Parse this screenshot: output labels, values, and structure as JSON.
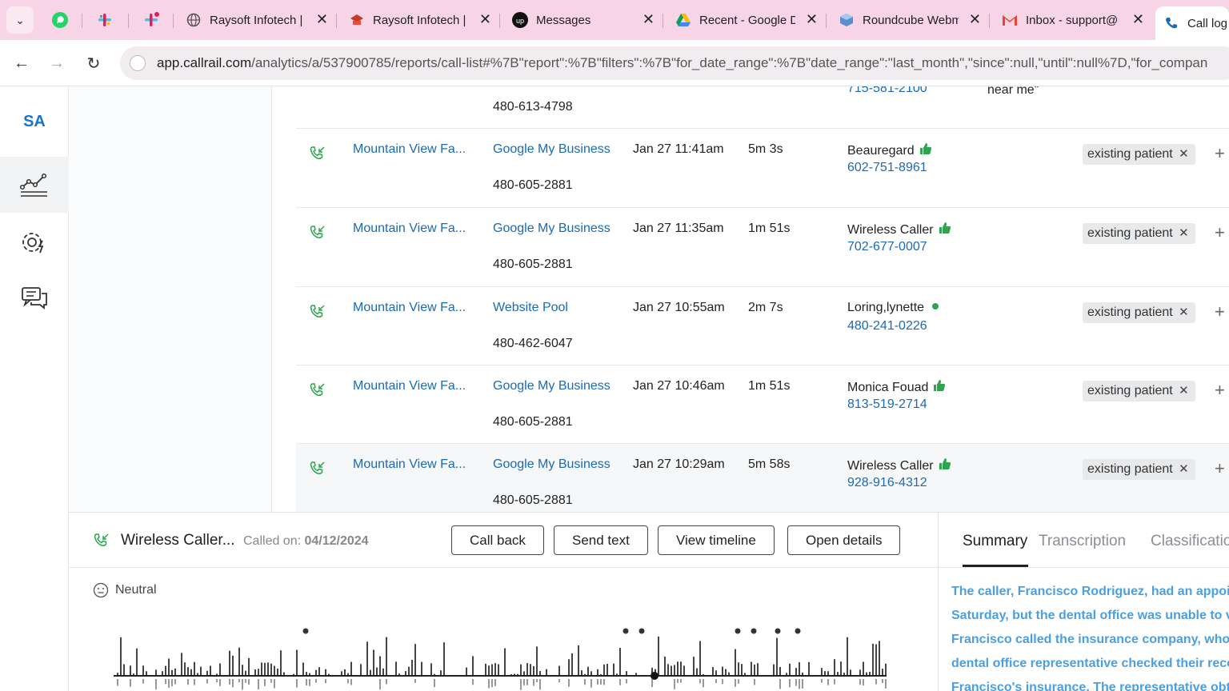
{
  "browser": {
    "tabs": [
      {
        "label": "Raysoft Infotech |",
        "icon": "globe-icon"
      },
      {
        "label": "Raysoft Infotech |",
        "icon": "hat-logo-icon"
      },
      {
        "label": "Messages",
        "icon": "upwork-icon"
      },
      {
        "label": "Recent - Google D",
        "icon": "google-drive-icon"
      },
      {
        "label": "Roundcube Webm",
        "icon": "roundcube-icon"
      },
      {
        "label": "Inbox - support@",
        "icon": "gmail-icon"
      },
      {
        "label": "Call log",
        "icon": "phone-icon"
      }
    ],
    "url_host": "app.callrail.com",
    "url_rest": "/analytics/a/537900785/reports/call-list#%7B\"report\":%7B\"filters\":%7B\"for_date_range\":%7B\"date_range\":\"last_month\",\"since\":null,\"until\":null%7D,\"for_compan"
  },
  "sidebar": {
    "logo": "SA",
    "items": [
      {
        "icon": "analytics-chart-icon",
        "active": true
      },
      {
        "icon": "settings-gear-icon",
        "active": false
      },
      {
        "icon": "chat-bubbles-icon",
        "active": false
      }
    ]
  },
  "top_partial": {
    "tracking": "480-613-4798",
    "caller_phone": "715-581-2100",
    "keyword": "near me\""
  },
  "rows": [
    {
      "company": "Mountain View Fa...",
      "source": "Google My Business",
      "tracking": "480-605-2881",
      "datetime": "Jan 27 11:41am",
      "duration": "5m 3s",
      "caller": "Beauregard",
      "phone": "602-751-8961",
      "indicator": "thumb",
      "tag": "existing patient"
    },
    {
      "company": "Mountain View Fa...",
      "source": "Google My Business",
      "tracking": "480-605-2881",
      "datetime": "Jan 27 11:35am",
      "duration": "1m 51s",
      "caller": "Wireless Caller",
      "phone": "702-677-0007",
      "indicator": "thumb",
      "tag": "existing patient"
    },
    {
      "company": "Mountain View Fa...",
      "source": "Website Pool",
      "tracking": "480-462-6047",
      "datetime": "Jan 27 10:55am",
      "duration": "2m 7s",
      "caller": "Loring,lynette",
      "phone": "480-241-0226",
      "indicator": "dot",
      "tag": "existing patient"
    },
    {
      "company": "Mountain View Fa...",
      "source": "Google My Business",
      "tracking": "480-605-2881",
      "datetime": "Jan 27 10:46am",
      "duration": "1m 51s",
      "caller": "Monica Fouad",
      "phone": "813-519-2714",
      "indicator": "thumb",
      "tag": "existing patient"
    },
    {
      "company": "Mountain View Fa...",
      "source": "Google My Business",
      "tracking": "480-605-2881",
      "datetime": "Jan 27 10:29am",
      "duration": "5m 58s",
      "caller": "Wireless Caller",
      "phone": "928-916-4312",
      "indicator": "thumb",
      "tag": "existing patient"
    }
  ],
  "detail": {
    "title": "Wireless Caller...",
    "called_label": "Called on: ",
    "called_date": "04/12/2024",
    "buttons": {
      "call_back": "Call back",
      "send_text": "Send text",
      "view_timeline": "View timeline",
      "open_details": "Open details"
    },
    "sentiment": "Neutral"
  },
  "summary": {
    "tabs": {
      "summary": "Summary",
      "transcription": "Transcription",
      "classification": "Classification"
    },
    "lines": [
      "The caller, Francisco Rodriguez, had an appoint",
      "Saturday, but the dental office was unable to ve",
      "Francisco called the insurance company, who c",
      "dental office representative checked their reco",
      "Francisco's insurance. The representative obta"
    ]
  },
  "colors": {
    "link": "#1a6ab4",
    "accent": "#2ea44f",
    "summary_text": "#4b9fe0",
    "tab_bar": "#f7d4e6"
  }
}
